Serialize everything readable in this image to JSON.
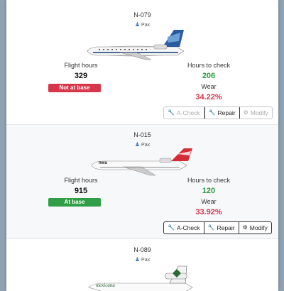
{
  "top_buttons": [
    "",
    ""
  ],
  "aircraft": [
    {
      "registration": "N-079",
      "type_label": "Pax",
      "flight_hours_label": "Flight hours",
      "flight_hours": "329",
      "status": "Not at base",
      "status_color": "#d6354a",
      "hours_to_check_label": "Hours to check",
      "hours_to_check": "206",
      "wear_label": "Wear",
      "wear": "34.22%",
      "buttons": {
        "acheck": "A-Check",
        "repair": "Repair",
        "modify": "Modify"
      },
      "livery": "white-blue-tail"
    },
    {
      "registration": "N-015",
      "type_label": "Pax",
      "flight_hours_label": "Flight hours",
      "flight_hours": "915",
      "status": "At base",
      "status_color": "#2f9e44",
      "hours_to_check_label": "Hours to check",
      "hours_to_check": "120",
      "wear_label": "Wear",
      "wear": "33.92%",
      "buttons": {
        "acheck": "A-Check",
        "repair": "Repair",
        "modify": "Modify"
      },
      "livery": "white-red-tail"
    },
    {
      "registration": "N-089",
      "type_label": "Pax",
      "livery_text": "mexicana",
      "livery": "white-green-stripe"
    }
  ],
  "icons": {
    "person": "person-icon",
    "wrench": "wrench-icon",
    "gear": "gear-icon"
  }
}
